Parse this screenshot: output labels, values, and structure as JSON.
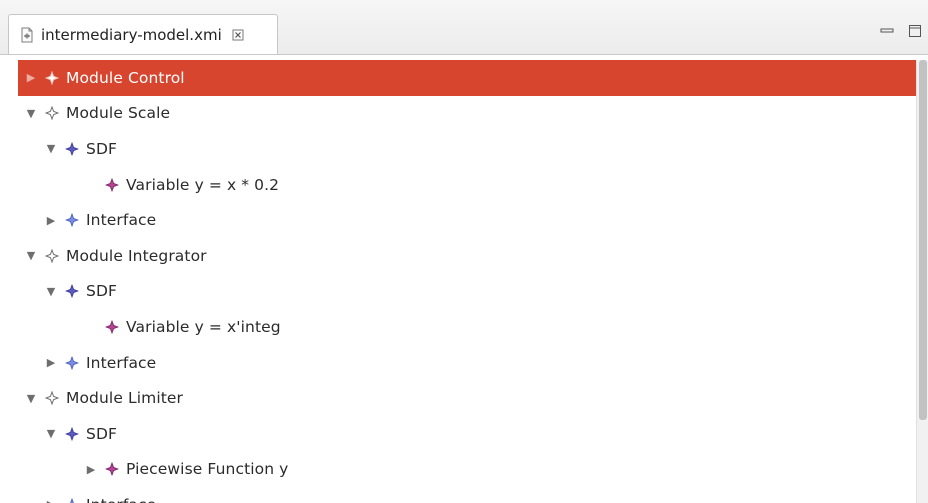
{
  "editor": {
    "tab_title": "intermediary-model.xmi",
    "icons": {
      "file": "xmi-file-icon",
      "close": "close-icon",
      "minimize": "minimize-icon",
      "maximize": "maximize-icon"
    }
  },
  "colors": {
    "selection": "#d8452f",
    "module_icon": "#7a7a7a",
    "sdf_icon": "#4f4fb0",
    "variable_icon": "#a0287d"
  },
  "tree": {
    "rows": [
      {
        "label": "Module Control",
        "depth": 0,
        "expander": "collapsed",
        "icon": "module-icon",
        "selected": true
      },
      {
        "label": "Module Scale",
        "depth": 0,
        "expander": "expanded",
        "icon": "module-icon",
        "selected": false
      },
      {
        "label": "SDF",
        "depth": 1,
        "expander": "expanded",
        "icon": "sdf-icon",
        "selected": false
      },
      {
        "label": "Variable y = x * 0.2",
        "depth": 2,
        "expander": "none",
        "icon": "variable-icon",
        "selected": false
      },
      {
        "label": "Interface",
        "depth": 1,
        "expander": "collapsed",
        "icon": "interface-icon",
        "selected": false
      },
      {
        "label": "Module Integrator",
        "depth": 0,
        "expander": "expanded",
        "icon": "module-icon",
        "selected": false
      },
      {
        "label": "SDF",
        "depth": 1,
        "expander": "expanded",
        "icon": "sdf-icon",
        "selected": false
      },
      {
        "label": "Variable y = x'integ",
        "depth": 2,
        "expander": "none",
        "icon": "variable-icon",
        "selected": false
      },
      {
        "label": "Interface",
        "depth": 1,
        "expander": "collapsed",
        "icon": "interface-icon",
        "selected": false
      },
      {
        "label": "Module Limiter",
        "depth": 0,
        "expander": "expanded",
        "icon": "module-icon",
        "selected": false
      },
      {
        "label": "SDF",
        "depth": 1,
        "expander": "expanded",
        "icon": "sdf-icon",
        "selected": false
      },
      {
        "label": "Piecewise Function y",
        "depth": 2,
        "expander": "collapsed",
        "icon": "function-icon",
        "selected": false
      },
      {
        "label": "Interface",
        "depth": 1,
        "expander": "collapsed",
        "icon": "interface-icon",
        "selected": false
      }
    ]
  }
}
